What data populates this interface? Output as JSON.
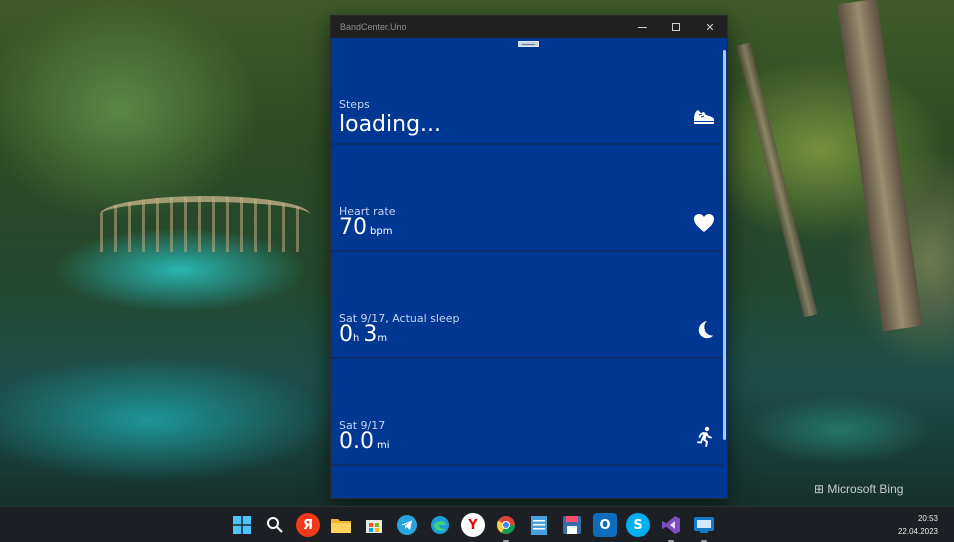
{
  "window": {
    "title": "BandCenter.Uno",
    "minimize_glyph": "—",
    "maximize_glyph": "☐",
    "close_glyph": "✕"
  },
  "tiles": [
    {
      "label": "Steps",
      "value": "loading...",
      "icon": "shoe-icon"
    },
    {
      "label": "Heart rate",
      "value": "70",
      "unit": "bpm",
      "icon": "heart-icon"
    },
    {
      "label": "Sat 9/17, Actual sleep",
      "hours": "0",
      "hours_unit": "h",
      "minutes": "3",
      "minutes_unit": "m",
      "icon": "moon-icon"
    },
    {
      "label": "Sat 9/17",
      "value": "0.0",
      "unit": "mi",
      "icon": "running-icon"
    }
  ],
  "desktop": {
    "watermark": "Microsoft Bing"
  },
  "taskbar": {
    "apps": [
      {
        "name": "start-button",
        "glyph": "",
        "color": "#2f8cff"
      },
      {
        "name": "search-icon",
        "glyph": "",
        "color": "transparent"
      },
      {
        "name": "yandex-icon",
        "glyph": "Я",
        "color": "#f23b1c"
      },
      {
        "name": "file-explorer-icon",
        "glyph": "",
        "color": "#f3b634"
      },
      {
        "name": "store-icon",
        "glyph": "",
        "color": "#eaeaea"
      },
      {
        "name": "telegram-icon",
        "glyph": "",
        "color": "#2aa3df"
      },
      {
        "name": "edge-icon",
        "glyph": "",
        "color": "#1a9ed9"
      },
      {
        "name": "yandex-browser-icon",
        "glyph": "Y",
        "color": "#ffffff"
      },
      {
        "name": "chrome-icon",
        "glyph": "",
        "color": "#ffffff"
      },
      {
        "name": "notepad-icon",
        "glyph": "",
        "color": "#4a9fdc"
      },
      {
        "name": "save-app-icon",
        "glyph": "",
        "color": "#3b6ea8"
      },
      {
        "name": "outlook-icon",
        "glyph": "O",
        "color": "#0f6cbd"
      },
      {
        "name": "skype-icon",
        "glyph": "S",
        "color": "#00aff0"
      },
      {
        "name": "visual-studio-icon",
        "glyph": "",
        "color": "#7d4cbf"
      },
      {
        "name": "remote-app-icon",
        "glyph": "",
        "color": "#1479c6"
      }
    ],
    "time": "20:53",
    "date": "22.04.2023"
  }
}
